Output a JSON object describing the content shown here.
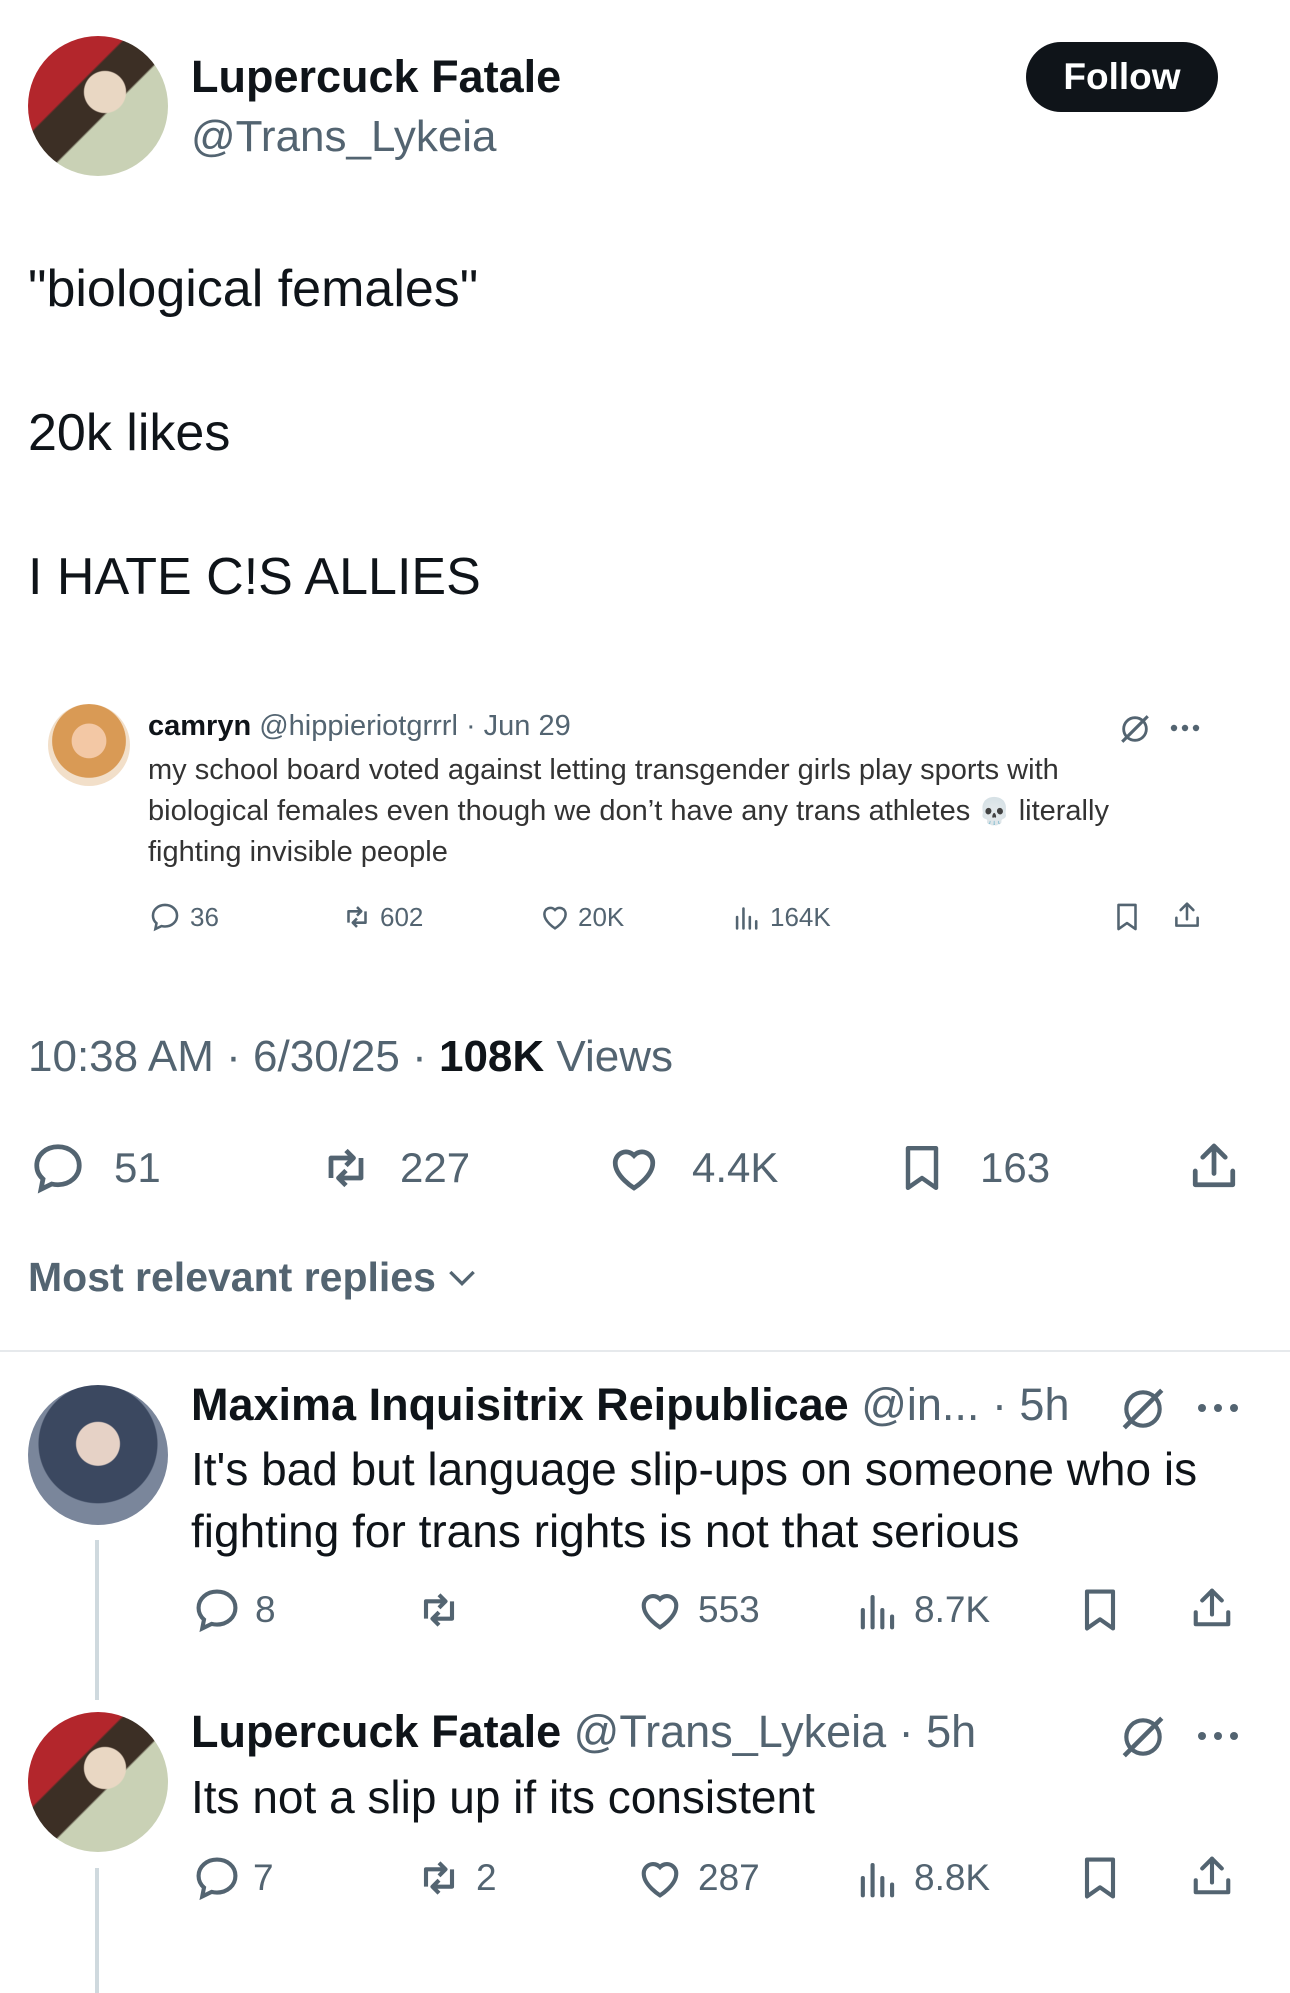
{
  "tweet": {
    "author_name": "Lupercuck Fatale",
    "author_handle": "@Trans_Lykeia",
    "follow_label": "Follow",
    "text_line1": "\"biological females\"",
    "text_line2": "20k likes",
    "text_line3": "I HATE C!S ALLIES",
    "time": "10:38 AM",
    "date": "6/30/25",
    "views_count": "108K",
    "views_label": "Views",
    "sep": "·",
    "stats": {
      "replies": "51",
      "reposts": "227",
      "likes": "4.4K",
      "bookmarks": "163"
    }
  },
  "quoted": {
    "name": "camryn",
    "handle": "@hippieriotgrrrl",
    "date": "· Jun 29",
    "text_line1": "my school board voted against letting transgender girls play sports with",
    "text_line2": "biological females even though we don’t have any trans athletes",
    "emoji": "💀",
    "text_line2b": "literally",
    "text_line3": "fighting invisible people",
    "stats": {
      "replies": "36",
      "reposts": "602",
      "likes": "20K",
      "views": "164K"
    }
  },
  "replies_header": "Most relevant replies",
  "replies": [
    {
      "name": "Maxima Inquisitrix Reipublicae",
      "handle": "@in...",
      "time": "· 5h",
      "text_line1": "It's bad but language slip-ups on someone who is",
      "text_line2": "fighting for trans rights is not that serious",
      "stats": {
        "replies": "8",
        "reposts": "",
        "likes": "553",
        "views": "8.7K"
      }
    },
    {
      "name": "Lupercuck Fatale",
      "handle": "@Trans_Lykeia",
      "time": "· 5h",
      "text_line1": "Its not a slip up if its consistent",
      "stats": {
        "replies": "7",
        "reposts": "2",
        "likes": "287",
        "views": "8.8K"
      }
    }
  ],
  "icons": [
    "reply-icon",
    "repost-icon",
    "like-icon",
    "bookmark-icon",
    "share-icon",
    "views-icon",
    "grok-icon",
    "more-icon",
    "chevron-down-icon"
  ]
}
